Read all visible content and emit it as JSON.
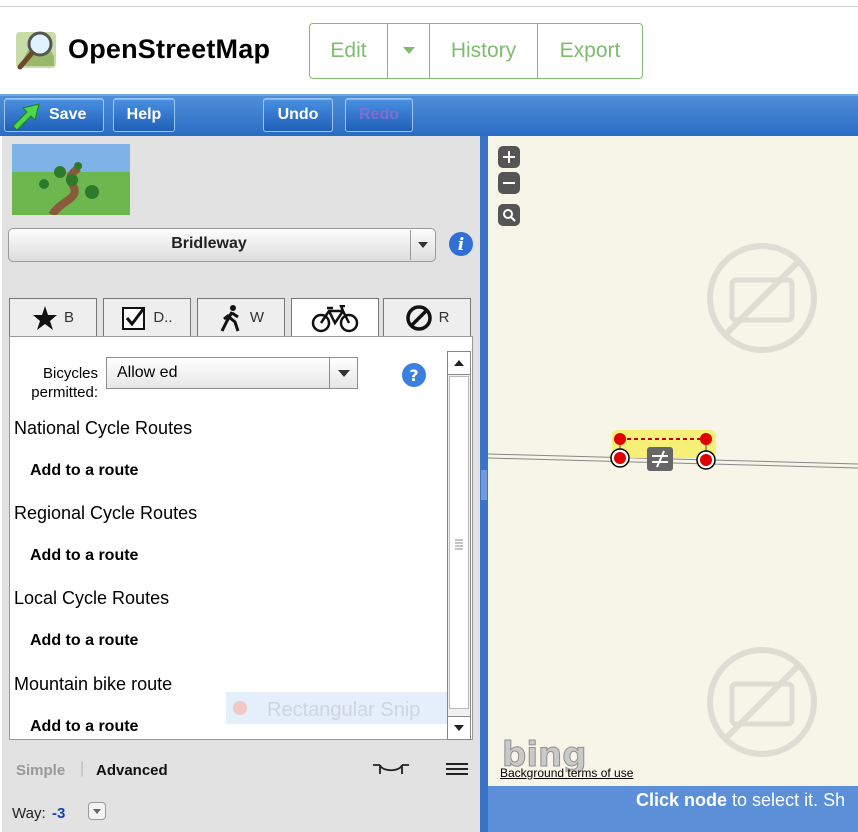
{
  "header": {
    "site_title": "OpenStreetMap",
    "nav": [
      "Edit",
      "History",
      "Export"
    ]
  },
  "toolbar": {
    "save": "Save",
    "help": "Help",
    "undo": "Undo",
    "redo": "Redo"
  },
  "panel": {
    "preset": "Bridleway",
    "tabs": [
      {
        "icon": "star-icon",
        "label": "B"
      },
      {
        "icon": "checkbox-icon",
        "label": "D.."
      },
      {
        "icon": "walker-icon",
        "label": "W"
      },
      {
        "icon": "bicycle-icon",
        "label": ""
      },
      {
        "icon": "no-entry-icon",
        "label": "R"
      }
    ],
    "active_tab": 3,
    "bicycles_permitted_label": "Bicycles permitted:",
    "bicycles_permitted_value": "Allow ed",
    "sections": [
      {
        "title": "National Cycle Routes",
        "action": "Add to a route"
      },
      {
        "title": "Regional Cycle Routes",
        "action": "Add to a route"
      },
      {
        "title": "Local Cycle Routes",
        "action": "Add to a route"
      },
      {
        "title": "Mountain bike route",
        "action": "Add to a route"
      }
    ],
    "modes": {
      "simple": "Simple",
      "separator": "|",
      "advanced": "Advanced"
    },
    "way_label": "Way:",
    "way_value": "-3"
  },
  "overlay": {
    "snip_text": "Rectangular Snip"
  },
  "map": {
    "attribution_link": "Background terms of use",
    "status_bold": "Click node",
    "status_rest": " to select it. Sh",
    "bing_logo_text": "bing"
  },
  "colors": {
    "osm_green": "#7ebc6f",
    "toolbar_blue": "#2b6cc4",
    "map_bg": "#f7f4e8",
    "selected_node": "#e00000",
    "highlight": "#f5f06a"
  }
}
